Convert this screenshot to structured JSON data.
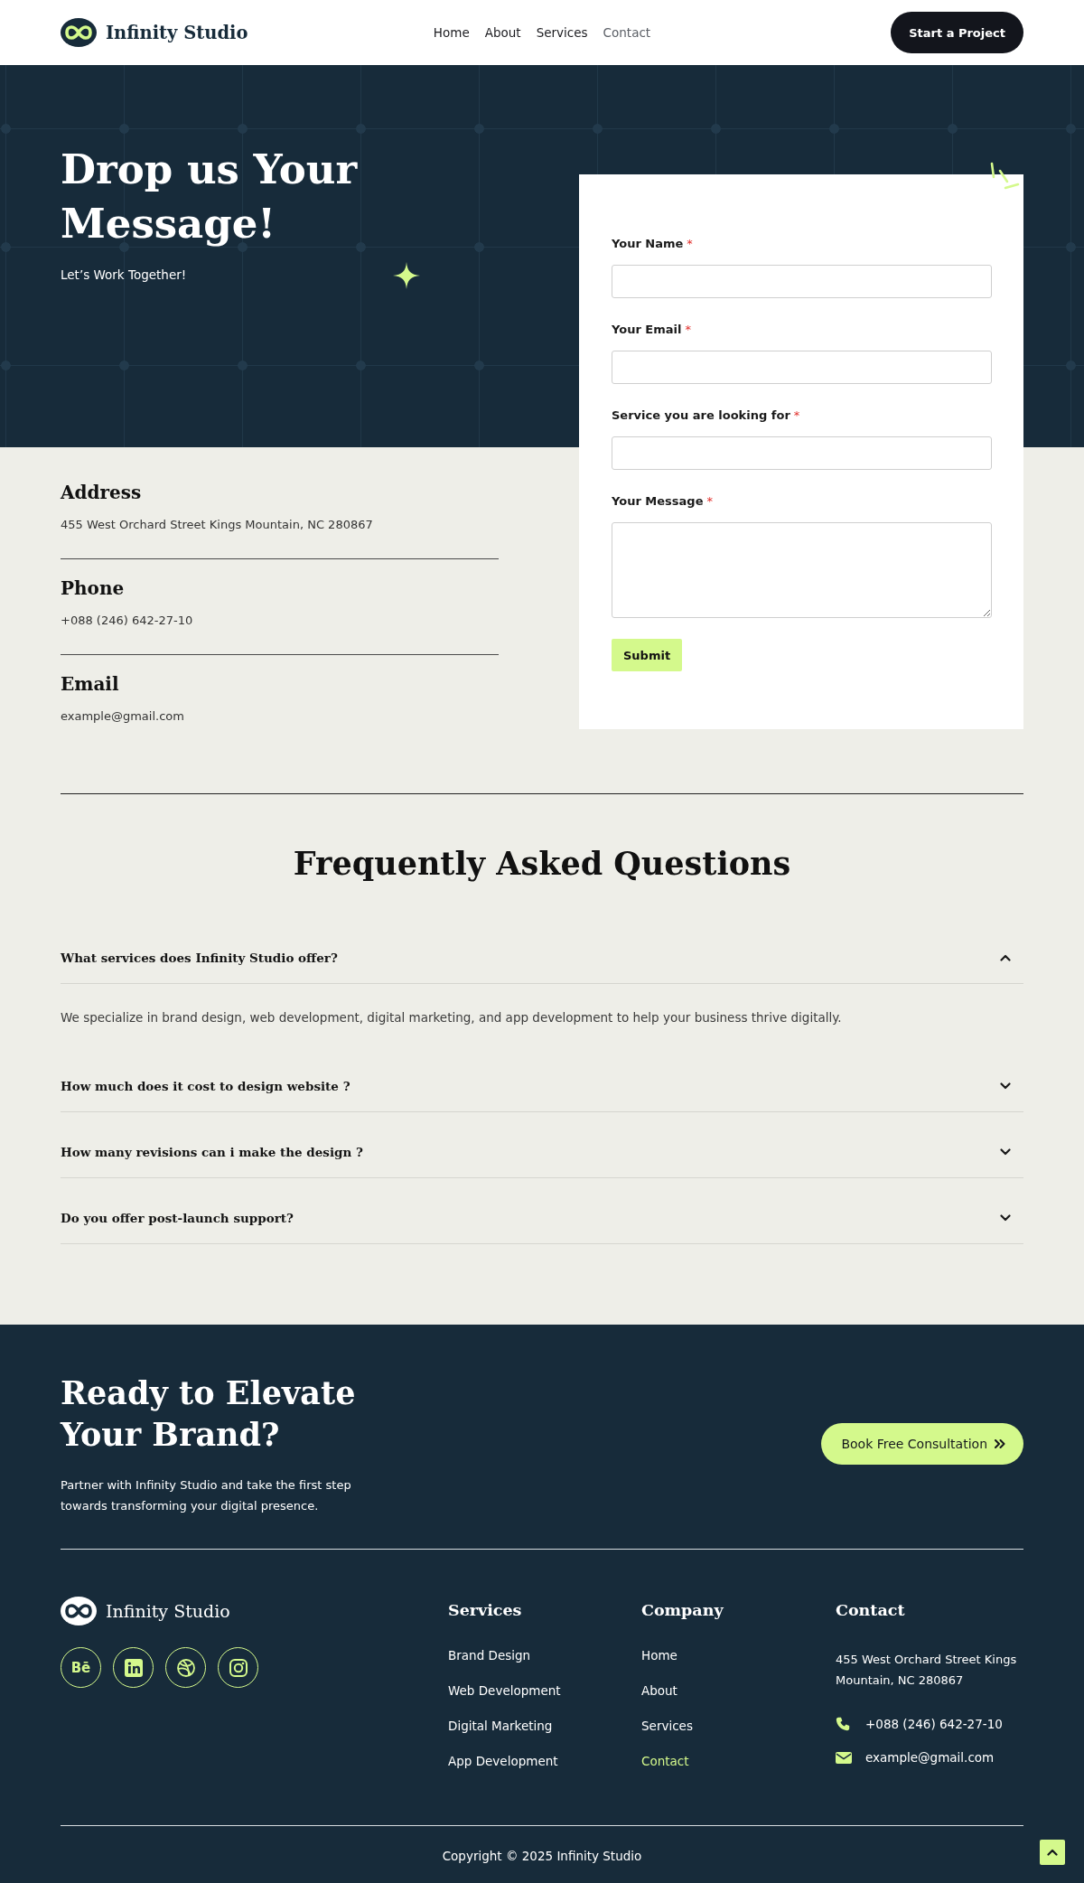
{
  "header": {
    "logo_text": "Infinity Studio",
    "nav": [
      {
        "label": "Home",
        "selected": false
      },
      {
        "label": "About",
        "selected": false
      },
      {
        "label": "Services",
        "selected": false
      },
      {
        "label": "Contact",
        "selected": true
      }
    ],
    "button": "Start a Project"
  },
  "hero": {
    "title": "Drop us Your Message!",
    "subtitle": "Let’s Work Together!"
  },
  "contact_form": {
    "fields": [
      {
        "label": "Your Name",
        "required_mark": "*",
        "kind": "input"
      },
      {
        "label": "Your Email",
        "required_mark": "*",
        "kind": "input"
      },
      {
        "label": "Service you are looking for",
        "required_mark": "*",
        "kind": "input"
      },
      {
        "label": "Your Message",
        "required_mark": "*",
        "kind": "textarea"
      }
    ],
    "submit": "Submit"
  },
  "contact_info": [
    {
      "heading": "Address",
      "text": "455 West Orchard Street Kings Mountain, NC 280867"
    },
    {
      "heading": "Phone",
      "text": "+088 (246) 642-27-10"
    },
    {
      "heading": "Email",
      "text": "example@gmail.com"
    }
  ],
  "faq": {
    "title": "Frequently Asked Questions",
    "items": [
      {
        "question": "What services does Infinity Studio offer?",
        "expanded": true,
        "answer": "We specialize in brand design, web development, digital marketing, and app development to help your business thrive digitally."
      },
      {
        "question": "How much does it cost to design website ?",
        "expanded": false
      },
      {
        "question": "How many revisions can i make the design ?",
        "expanded": false
      },
      {
        "question": "Do you offer post-launch support?",
        "expanded": false
      }
    ]
  },
  "cta": {
    "title": "Ready to Elevate Your Brand?",
    "text": "Partner with Infinity Studio and take the first step towards transforming your digital presence.",
    "button": "Book Free Consultation"
  },
  "footer": {
    "logo_text": "Infinity Studio",
    "social": [
      {
        "kind": "letters",
        "text": "Bē"
      },
      {
        "kind": "square-logo"
      },
      {
        "kind": "ball"
      },
      {
        "kind": "camera"
      }
    ],
    "columns": [
      {
        "heading": "Services",
        "links": [
          {
            "label": "Brand Design",
            "selected": false
          },
          {
            "label": "Web Development",
            "selected": false
          },
          {
            "label": "Digital Marketing",
            "selected": false
          },
          {
            "label": "App Development",
            "selected": false
          }
        ]
      },
      {
        "heading": "Company",
        "links": [
          {
            "label": "Home",
            "selected": false
          },
          {
            "label": "About",
            "selected": false
          },
          {
            "label": "Services",
            "selected": false
          },
          {
            "label": "Contact",
            "selected": true
          }
        ]
      }
    ],
    "contact": {
      "heading": "Contact",
      "items": [
        {
          "kind": "address",
          "text": "455 West Orchard Street Kings Mountain, NC 280867"
        },
        {
          "kind": "phone",
          "text": "+088 (246) 642-27-10"
        },
        {
          "kind": "email",
          "text": "example@gmail.com"
        }
      ]
    },
    "copyright": "Copyright © 2025 Infinity Studio"
  }
}
